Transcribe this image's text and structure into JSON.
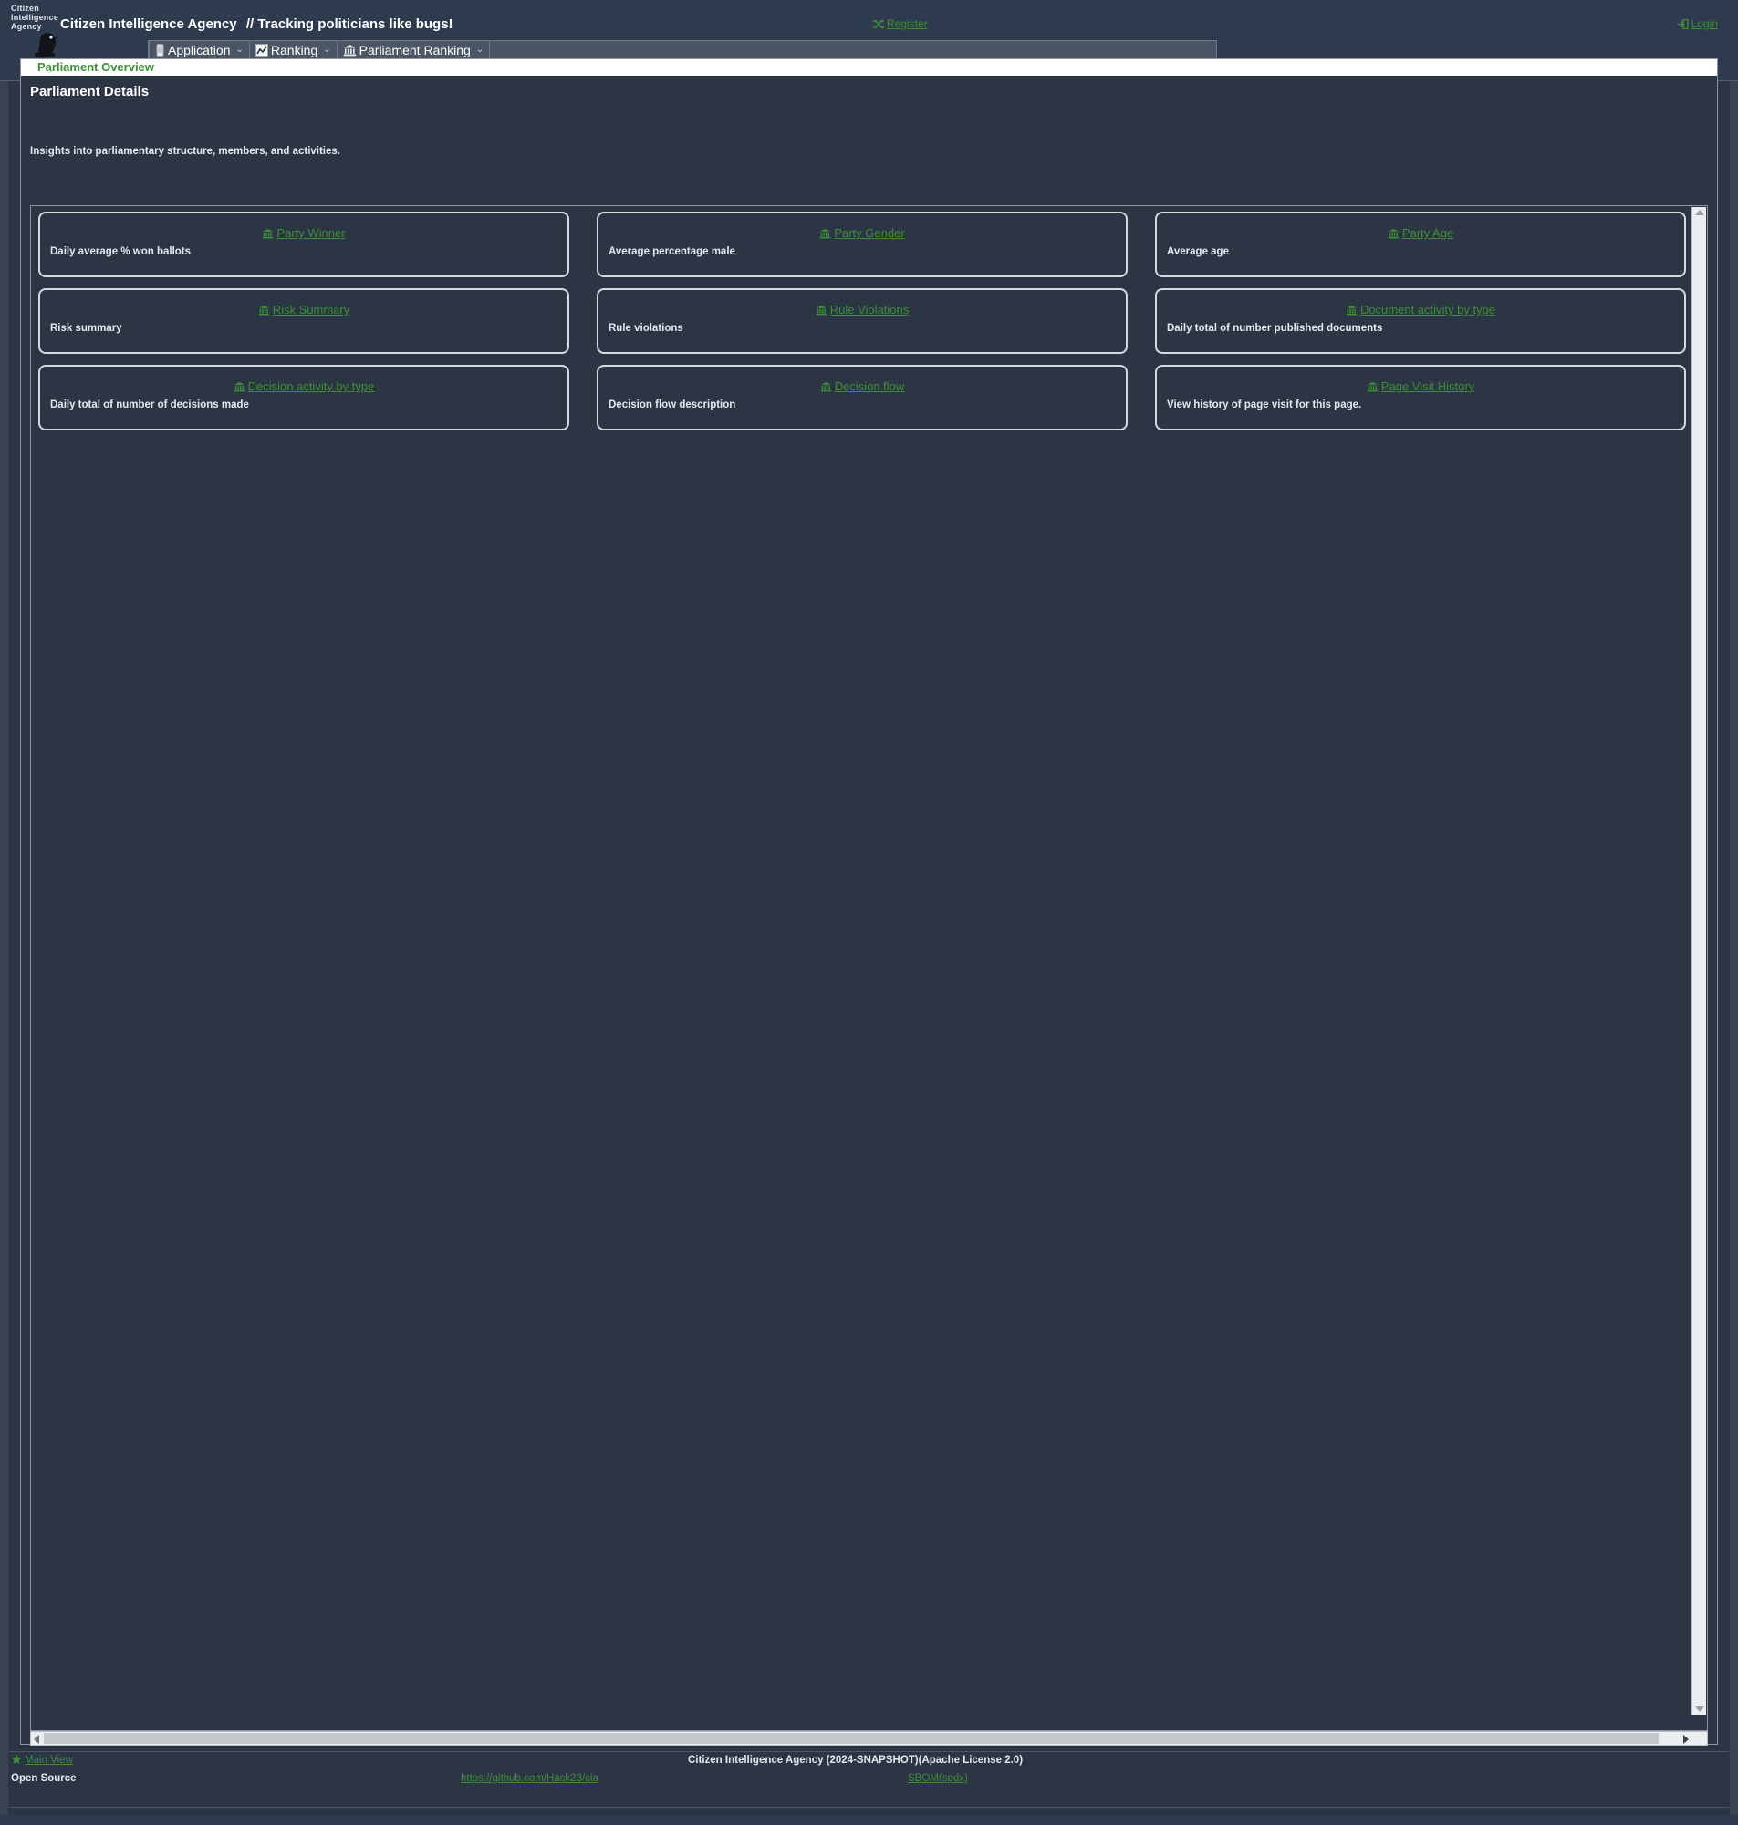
{
  "header": {
    "logo_lines": [
      "Citizen",
      "Intelligence",
      "Agency"
    ],
    "logo_icon": "bird-logo-icon",
    "site_title": "Citizen Intelligence Agency",
    "tagline": "// Tracking politicians like bugs!",
    "register_label": "Register",
    "register_icon": "shuffle-icon",
    "login_label": "Login",
    "login_icon": "login-arrow-icon"
  },
  "menu": {
    "items": [
      {
        "label": "Application",
        "icon": "document-icon",
        "caret": "⌄"
      },
      {
        "label": "Ranking",
        "icon": "chart-line-icon",
        "caret": "⌄"
      },
      {
        "label": "Parliament Ranking",
        "icon": "bank-icon",
        "caret": "⌄"
      }
    ]
  },
  "panel": {
    "tab_label": "Parliament Overview",
    "section_title": "Parliament Details",
    "section_sub": "Insights into parliamentary structure, members, and activities."
  },
  "cards": [
    [
      {
        "title": "Party Winner",
        "icon": "bank-icon",
        "desc": "Daily average % won ballots"
      },
      {
        "title": "Party Gender",
        "icon": "bank-icon",
        "desc": "Average percentage male"
      },
      {
        "title": "Party Age",
        "icon": "bank-icon",
        "desc": "Average age"
      }
    ],
    [
      {
        "title": "Risk Summary",
        "icon": "bank-icon",
        "desc": "Risk summary"
      },
      {
        "title": "Rule Violations",
        "icon": "bank-icon",
        "desc": "Rule violations"
      },
      {
        "title": "Document activity by type",
        "icon": "bank-icon",
        "desc": "Daily total of number published documents"
      }
    ],
    [
      {
        "title": "Decision activity by type",
        "icon": "bank-icon",
        "desc": "Daily total of number of decisions made"
      },
      {
        "title": "Decision flow",
        "icon": "bank-icon",
        "desc": "Decision flow description"
      },
      {
        "title": "Page Visit History",
        "icon": "bank-icon",
        "desc": "View history of page visit for this page."
      }
    ]
  ],
  "footer": {
    "main_view_label": "Main View",
    "main_view_icon": "star-icon",
    "copyright": "Citizen Intelligence Agency (2024-SNAPSHOT)(Apache License 2.0)",
    "open_source_label": "Open Source",
    "github_link": "https://github.com/Hack23/cia",
    "sbom_link": "SBOM(spdx)"
  },
  "colors": {
    "background": "#2b3544",
    "header_bg": "#2e3a4d",
    "accent_green": "#3e8e36",
    "text": "#ffffff",
    "border": "#8c949e"
  }
}
